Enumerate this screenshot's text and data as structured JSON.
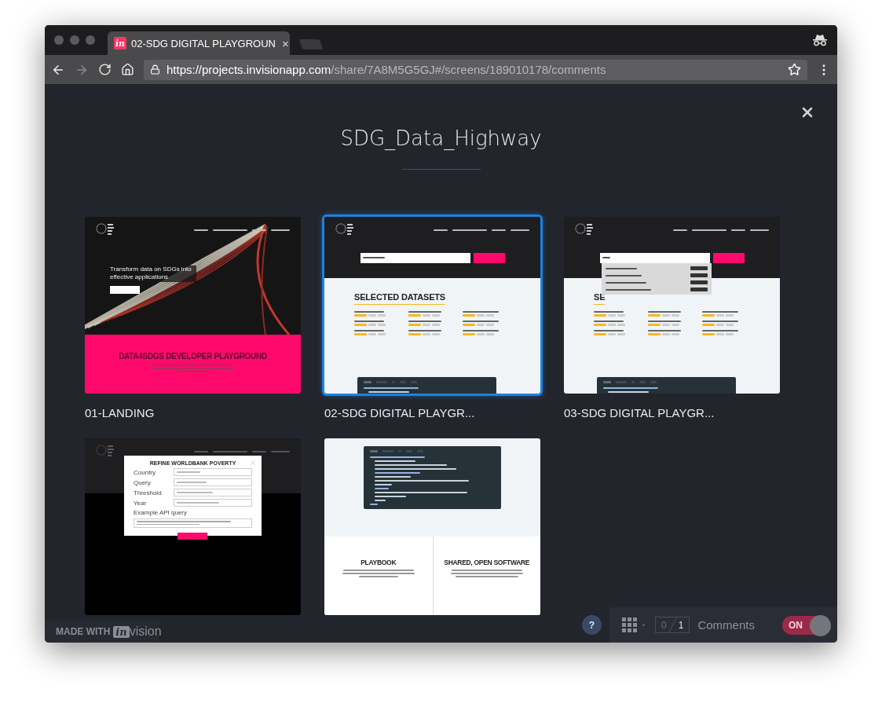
{
  "browser": {
    "tab": {
      "logo": "in",
      "title": "02-SDG DIGITAL PLAYGROUN",
      "close": "×"
    },
    "url": {
      "host": "https://projects.invisionapp.com",
      "path": "/share/7A8M5G5GJ#/screens/189010178/comments"
    }
  },
  "page": {
    "title": "SDG_Data_Highway",
    "screens": [
      {
        "label": "01-LANDING",
        "selected": false,
        "kind": "landing",
        "tagline": "Transform data on SDGs into effective applications",
        "heading": "DATA4SDGS DEVELOPER PLAYGROUND"
      },
      {
        "label": "02-SDG DIGITAL PLAYGR...",
        "selected": true,
        "kind": "datasets",
        "heading": "SELECTED DATASETS"
      },
      {
        "label": "03-SDG DIGITAL PLAYGR...",
        "selected": false,
        "kind": "search",
        "heading": "SE"
      },
      {
        "selected": false,
        "kind": "modal",
        "modal": {
          "title": "REFINE WORLDBANK POVERTY",
          "fields": [
            "Country",
            "Query",
            "Threshold",
            "Year"
          ],
          "query_label": "Example API query"
        }
      },
      {
        "selected": false,
        "kind": "sections",
        "sections": [
          "PLAYBOOK",
          "SHARED, OPEN SOFTWARE"
        ]
      }
    ]
  },
  "footer": {
    "badge": {
      "prefix": "MADE WITH",
      "logo": "in",
      "brand": "vision"
    },
    "help": "?",
    "counter": {
      "unread": "0",
      "total": "1"
    },
    "comments": "Comments",
    "toggle": {
      "label": "ON",
      "on": true
    }
  }
}
